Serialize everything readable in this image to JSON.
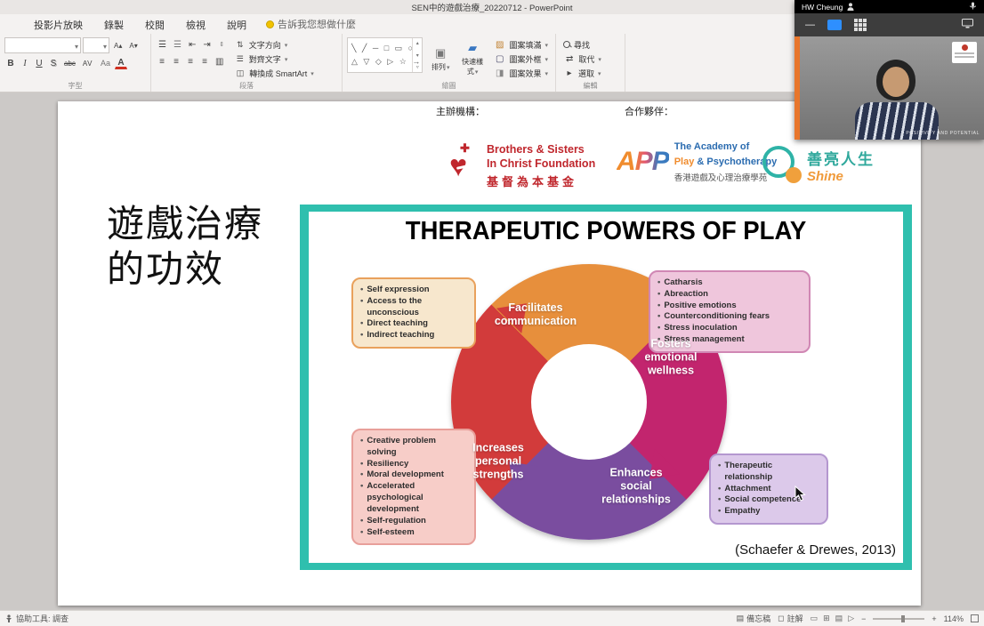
{
  "window": {
    "title": "SEN中的遊戲治療_20220712 - PowerPoint"
  },
  "ribbon": {
    "tabs": [
      "投影片放映",
      "錄製",
      "校閱",
      "檢視",
      "說明"
    ],
    "tell_me": "告訴我您想做什麼",
    "groups": {
      "font": {
        "label": "字型"
      },
      "paragraph": {
        "label": "段落",
        "buttons": [
          "文字方向",
          "對齊文字",
          "轉換成 SmartArt"
        ]
      },
      "drawing": {
        "label": "繪圖",
        "arrange": "排列",
        "quick_styles": "快速樣式",
        "fill": "圖案填滿",
        "outline": "圖案外框",
        "effects": "圖案效果"
      },
      "editing": {
        "label": "編輯",
        "find": "尋找",
        "replace": "取代",
        "select": "選取"
      }
    }
  },
  "slide": {
    "organizer_label": "主辦機構：",
    "partner_label": "合作夥伴：",
    "side_title": "遊戲治療\n的功效",
    "logos": {
      "bsc": {
        "name_line1": "Brothers & Sisters",
        "name_line2": "In Christ Foundation",
        "name_line3": "基督為本基金"
      },
      "app": {
        "abbr": "APP",
        "line1": "The Academy of",
        "play": "Play",
        "rest": " & Psychotherapy",
        "line3": "香港遊戲及心理治療學苑"
      },
      "shine": {
        "cn": "善亮人生",
        "en": "Shine"
      }
    },
    "diagram": {
      "title": "THERAPEUTIC POWERS OF PLAY",
      "citation": "(Schaefer & Drewes, 2013)",
      "facilitates": {
        "label": "Facilitates\ncommunication",
        "items": [
          "Self expression",
          "Access to the unconscious",
          "Direct teaching",
          "Indirect teaching"
        ]
      },
      "fosters": {
        "label": "Fosters\nemotional\nwellness",
        "items": [
          "Catharsis",
          "Abreaction",
          "Positive emotions",
          "Counterconditioning fears",
          "Stress inoculation",
          "Stress management"
        ]
      },
      "increases": {
        "label": "Increases\npersonal\nstrengths",
        "items": [
          "Creative problem solving",
          "Resiliency",
          "Moral development",
          "Accelerated psychological development",
          "Self-regulation",
          "Self-esteem"
        ]
      },
      "enhances": {
        "label": "Enhances\nsocial\nrelationships",
        "items": [
          "Therapeutic relationship",
          "Attachment",
          "Social competence",
          "Empathy"
        ]
      }
    }
  },
  "video_overlay": {
    "participant_name": "HW Cheung",
    "caption": "POSITIVITY AND POTENTIAL"
  },
  "status_bar": {
    "accessibility": "協助工具: 調查",
    "notes": "備忘稿",
    "comments": "註解",
    "zoom": "114%"
  },
  "colors": {
    "teal_frame": "#2fbfae",
    "segment_orange": "#e78f3c",
    "segment_magenta": "#c2256e",
    "segment_purple": "#7a4d9f",
    "segment_red": "#d23b3b"
  }
}
